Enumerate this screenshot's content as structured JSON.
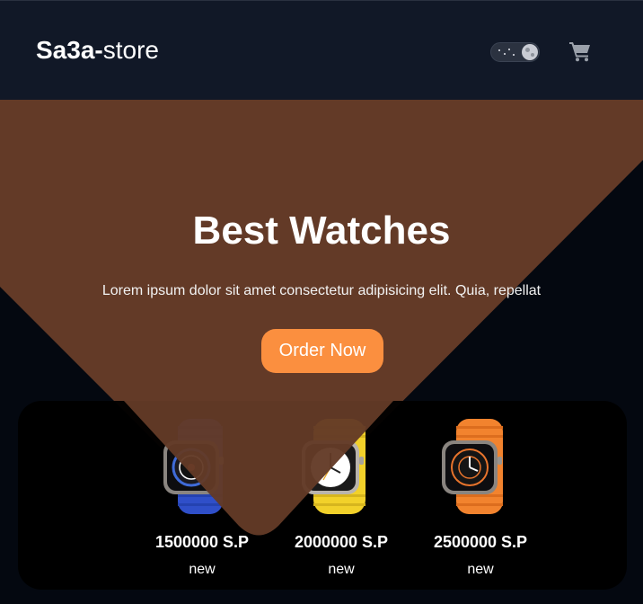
{
  "nav": {
    "brand_strong": "Sa3a-",
    "brand_rest": "store",
    "theme_toggle_icon": "dark-mode-toggle",
    "cart_icon": "shopping-cart-icon"
  },
  "hero": {
    "title": "Best Watches",
    "subtitle": "Lorem ipsum dolor sit amet consectetur adipisicing elit. Quia, repellat",
    "cta_label": "Order Now"
  },
  "products": [
    {
      "price": "1500000 S.P",
      "tag": "new",
      "band_color": "#2f4fc9"
    },
    {
      "price": "2000000 S.P",
      "tag": "new",
      "band_color": "#f2d12a"
    },
    {
      "price": "2500000 S.P",
      "tag": "new",
      "band_color": "#f2832e"
    }
  ],
  "colors": {
    "navbar": "#111827",
    "hero_brown": "#633a27",
    "accent_orange": "#fb8f3f",
    "background": "#040810"
  }
}
